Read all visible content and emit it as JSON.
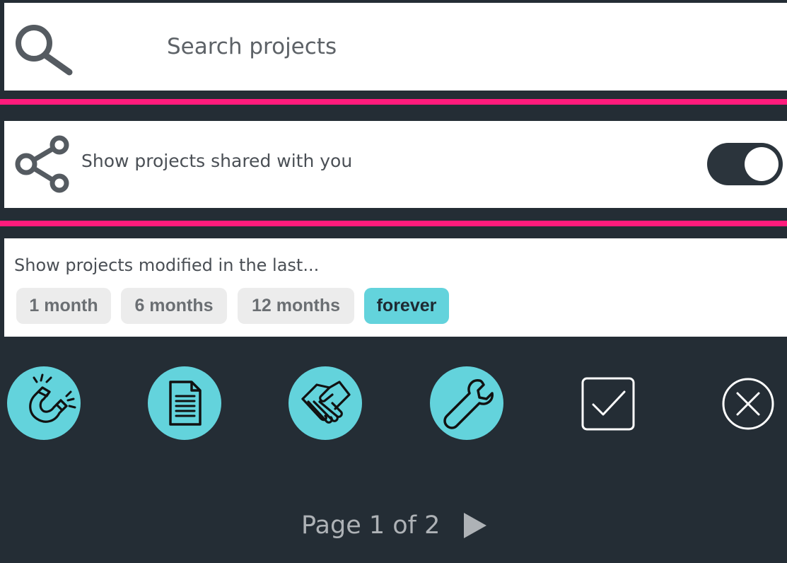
{
  "search": {
    "placeholder": "Search projects",
    "value": ""
  },
  "shared": {
    "label": "Show projects shared with you",
    "toggle_on": true
  },
  "modified_filter": {
    "label": "Show projects modified in the last...",
    "options": [
      "1 month",
      "6 months",
      "12 months",
      "forever"
    ],
    "selected": "forever"
  },
  "action_icons": [
    "magnet-icon",
    "document-icon",
    "handshake-icon",
    "wrench-icon",
    "checkbox-icon",
    "close-circle-icon"
  ],
  "pager": {
    "label": "Page 1 of 2"
  },
  "colors": {
    "background": "#242d35",
    "accent_pink": "#ff1b7c",
    "accent_cyan": "#63d3dc",
    "panel": "#ffffff",
    "chip": "#ececec"
  }
}
